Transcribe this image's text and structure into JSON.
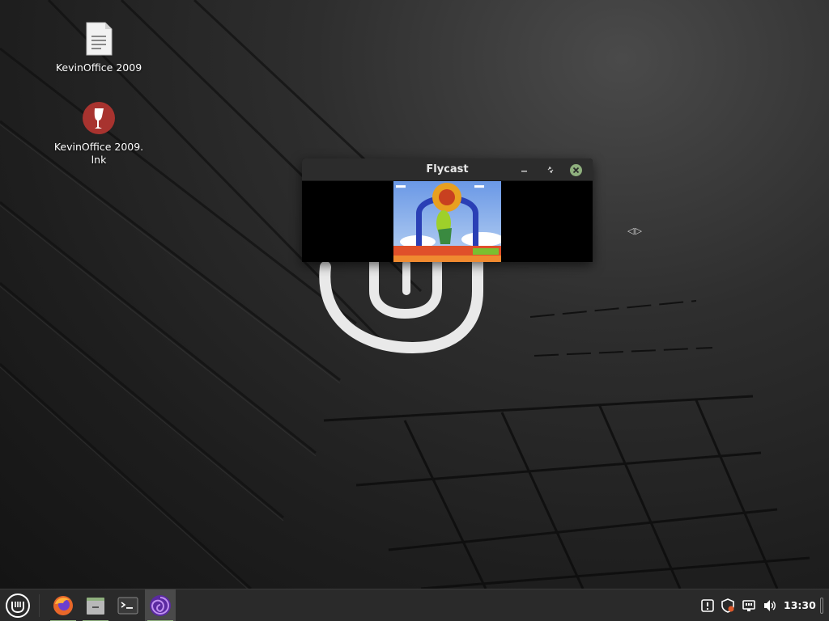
{
  "desktop": {
    "icons": [
      {
        "label": "KevinOffice 2009",
        "icon": "document-icon"
      },
      {
        "label": "KevinOffice 2009.\nlnk",
        "icon": "wine-icon"
      }
    ],
    "resize_hint": "◁▷"
  },
  "window": {
    "title": "Flycast",
    "app": "Flycast emulator",
    "buttons": {
      "minimize": "minimize",
      "maximize": "maximize",
      "close": "close"
    }
  },
  "taskbar": {
    "menu_icon": "mint-menu-icon",
    "launchers": [
      {
        "name": "Firefox",
        "icon": "firefox-icon"
      },
      {
        "name": "Files",
        "icon": "files-icon"
      },
      {
        "name": "Terminal",
        "icon": "terminal-icon"
      },
      {
        "name": "Flycast",
        "icon": "flycast-icon",
        "active": true
      }
    ],
    "tray": [
      {
        "name": "notifications",
        "icon": "notification-icon"
      },
      {
        "name": "update-manager",
        "icon": "shield-icon"
      },
      {
        "name": "network",
        "icon": "network-icon"
      },
      {
        "name": "volume",
        "icon": "volume-icon"
      }
    ],
    "clock": "13:30"
  },
  "colors": {
    "accent": "#8fb07e",
    "taskbar_bg": "#2a2a2a",
    "titlebar_bg": "#2c2c2c"
  }
}
